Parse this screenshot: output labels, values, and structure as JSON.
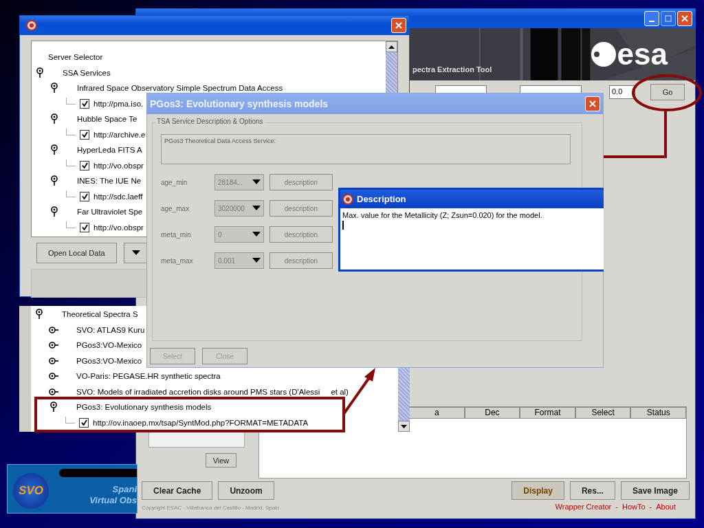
{
  "main_window": {
    "banner_text": "pectra Extraction Tool",
    "logo_text": "esa",
    "size_value": "0.0",
    "go_button": "Go",
    "table_columns": [
      "a",
      "Dec",
      "Format",
      "Select",
      "Status"
    ],
    "view_button": "View",
    "left_buttons": [
      "Clear Cache",
      "Unzoom"
    ],
    "right_buttons": [
      {
        "label": "Display",
        "kind": "primary"
      },
      {
        "label": "Res...",
        "kind": "normal"
      },
      {
        "label": "Save Image",
        "kind": "normal"
      }
    ],
    "copyright": "Copyright ESAC - Villafranca del Castillo - Madrid, Spain",
    "link_separator": "-",
    "links": [
      "Wrapper Creator",
      "HowTo",
      "About"
    ]
  },
  "server_selector": {
    "tree": [
      {
        "kind": "root",
        "label": "Server Selector",
        "children": [
          {
            "kind": "node",
            "label": "SSA Services",
            "expanded": true,
            "children": [
              {
                "kind": "node",
                "label": "Infrared Space Observatory Simple Spectrum Data Access",
                "expanded": true,
                "children": [
                  {
                    "kind": "url",
                    "label": "http://pma.iso.",
                    "checked": true
                  }
                ]
              },
              {
                "kind": "node",
                "label": "Hubble Space Te",
                "expanded": true,
                "children": [
                  {
                    "kind": "url",
                    "label": "http://archive.e",
                    "checked": true
                  }
                ]
              },
              {
                "kind": "node",
                "label": "HyperLeda FITS A",
                "expanded": true,
                "children": [
                  {
                    "kind": "url",
                    "label": "http://vo.obspr",
                    "checked": true
                  }
                ]
              },
              {
                "kind": "node",
                "label": "INES: The IUE Ne",
                "expanded": true,
                "children": [
                  {
                    "kind": "url",
                    "label": "http://sdc.laeff",
                    "checked": true
                  }
                ]
              },
              {
                "kind": "node",
                "label": "Far Ultraviolet Spe",
                "expanded": true,
                "children": [
                  {
                    "kind": "url",
                    "label": "http://vo.obspr",
                    "checked": true
                  }
                ]
              }
            ]
          }
        ]
      }
    ],
    "open_button": "Open Local Data"
  },
  "services_list": {
    "tree": [
      {
        "kind": "node",
        "label": "Theoretical Spectra S",
        "expanded": true,
        "children": [
          {
            "kind": "node",
            "label": "SVO: ATLAS9 Kuru",
            "expanded": false
          },
          {
            "kind": "node",
            "label": "PGos3:VO-Mexico",
            "expanded": false
          },
          {
            "kind": "node",
            "label": "PGos3:VO-Mexico",
            "expanded": false
          },
          {
            "kind": "node",
            "label": "VO-Paris: PEGASE.HR synthetic spectra",
            "expanded": false
          },
          {
            "kind": "node",
            "label": "SVO: Models of irradiated accretion disks around PMS stars (D'Alessi",
            "tail": "et al)",
            "expanded": false
          },
          {
            "kind": "node",
            "label": "PGos3: Evolutionary synthesis models",
            "expanded": true,
            "children": [
              {
                "kind": "url",
                "label": "http://ov.inaoep.mx/tsap/SyntMod.php?FORMAT=METADATA",
                "checked": true
              }
            ]
          }
        ]
      }
    ]
  },
  "svo_logo": {
    "badge": "SVO",
    "lines": [
      "Spani",
      "Virtual Obs"
    ]
  },
  "dialog": {
    "title": "PGos3: Evolutionary synthesis models",
    "group_title": "TSA Service Description & Options",
    "service_text": "PGos3 Theoretical Data Access Service:",
    "params": [
      {
        "name": "age_min",
        "value": "28184...",
        "button": "description"
      },
      {
        "name": "age_max",
        "value": "3020000",
        "button": "description"
      },
      {
        "name": "meta_min",
        "value": "0",
        "button": "description"
      },
      {
        "name": "meta_max",
        "value": "0.001",
        "button": "description"
      }
    ],
    "buttons": [
      {
        "label": "Select",
        "disabled": true
      },
      {
        "label": "Close",
        "disabled": true
      }
    ]
  },
  "description": {
    "title": "Description",
    "text": "Max. value for the Metallicity (Z; Zsun=0.020) for the model."
  }
}
